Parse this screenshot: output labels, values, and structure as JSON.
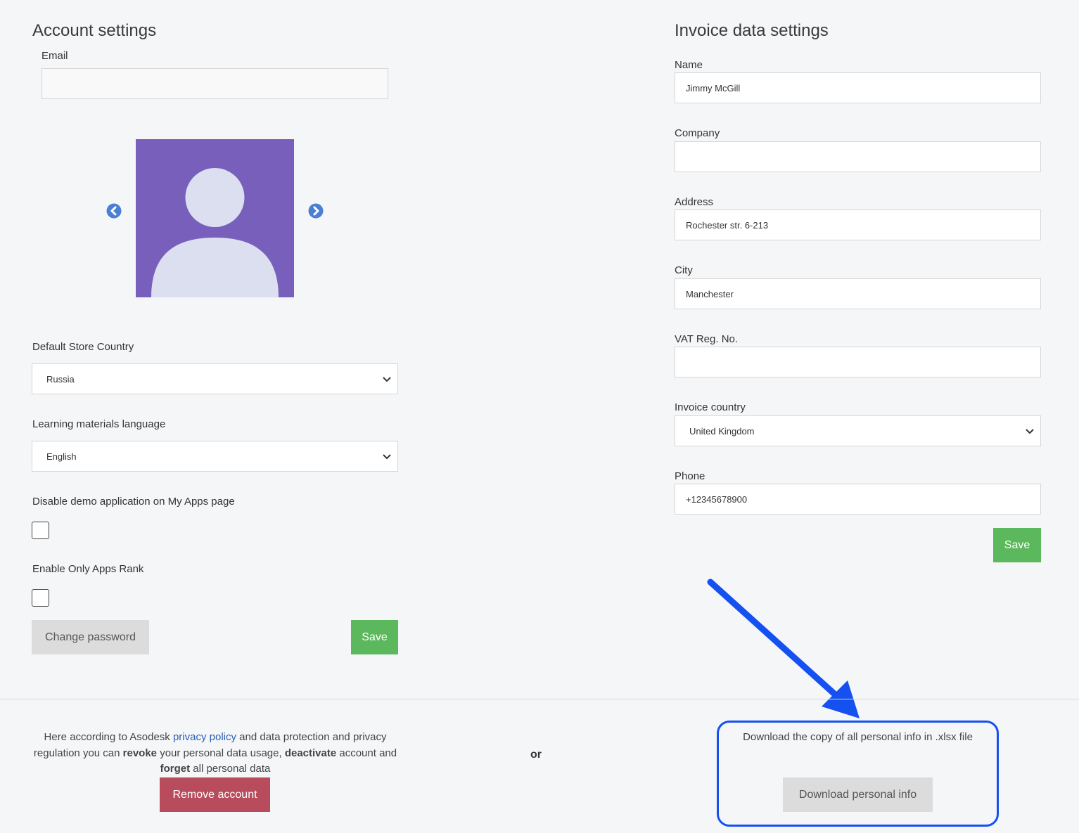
{
  "account": {
    "title": "Account settings",
    "email_label": "Email",
    "email_value": "",
    "default_country_label": "Default Store Country",
    "default_country_value": "Russia",
    "language_label": "Learning materials language",
    "language_value": "English",
    "disable_demo_label": "Disable demo application on My Apps page",
    "enable_rank_label": "Enable Only Apps Rank",
    "change_password_label": "Change password",
    "save_label": "Save"
  },
  "invoice": {
    "title": "Invoice data settings",
    "name_label": "Name",
    "name_value": "Jimmy McGill",
    "company_label": "Company",
    "company_value": "",
    "address_label": "Address",
    "address_value": "Rochester str. 6-213",
    "city_label": "City",
    "city_value": "Manchester",
    "vat_label": "VAT Reg. No.",
    "vat_value": "",
    "country_label": "Invoice country",
    "country_value": "United Kingdom",
    "phone_label": "Phone",
    "phone_value": "+12345678900",
    "save_label": "Save"
  },
  "footer": {
    "privacy_pre": "Here according to Asodesk ",
    "privacy_link": "privacy policy",
    "privacy_mid1": " and data protection and privacy regulation you can ",
    "privacy_revoke": "revoke",
    "privacy_mid2": " your personal data usage, ",
    "privacy_deactivate": "deactivate",
    "privacy_mid3": " account and ",
    "privacy_forget": "forget",
    "privacy_post": " all personal data",
    "remove_label": "Remove account",
    "or_label": "or",
    "download_text": "Download the copy of all personal info in .xlsx file",
    "download_label": "Download personal info"
  },
  "colors": {
    "avatar_bg": "#775fbb",
    "avatar_fg": "#dcdff0",
    "arrow": "#1550f0",
    "nav_icon": "#4a7fd4",
    "save_green": "#5cb85c",
    "remove_red": "#b84c5c"
  },
  "icons": {
    "avatar_prev": "chevron-left-circle-icon",
    "avatar_next": "chevron-right-circle-icon",
    "select_arrow": "chevron-down-icon"
  }
}
